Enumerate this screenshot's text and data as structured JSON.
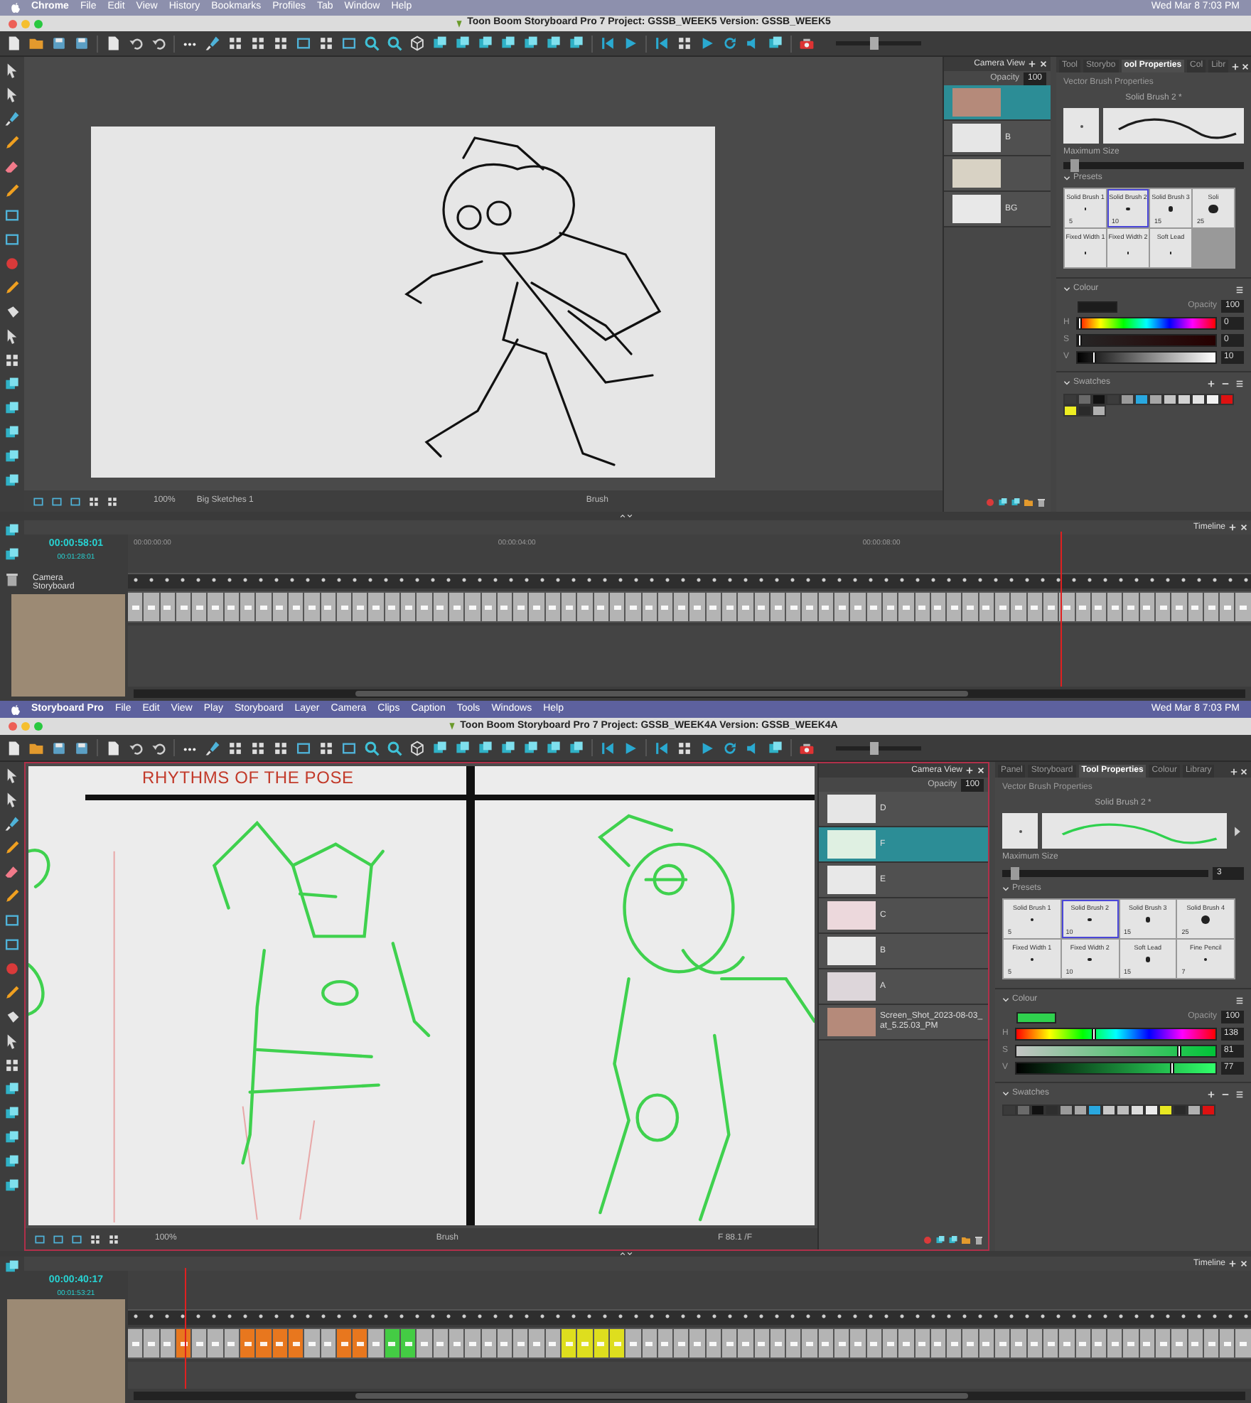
{
  "screens": [
    {
      "menu_bar": {
        "items": [
          "Chrome",
          "File",
          "Edit",
          "View",
          "History",
          "Bookmarks",
          "Profiles",
          "Tab",
          "Window",
          "Help"
        ],
        "clock": "Wed Mar 8  7:03 PM"
      },
      "window": {
        "title": "Toon Boom Storyboard Pro 7 Project: GSSB_WEEK5 Version: GSSB_WEEK5"
      },
      "toolbar": {
        "zoom_slider": {
          "level": 0.45
        }
      },
      "canvas": {
        "kind": "single",
        "status": {
          "zoom": "100%",
          "layer": "Big Sketches 1",
          "tool": "Brush"
        }
      },
      "camera_view": {
        "title": "Camera View",
        "opacity_label": "Opacity",
        "opacity": "100",
        "layers": [
          {
            "kind": "photo",
            "selected": true
          },
          {
            "kind": "sketch",
            "label": "B",
            "selected": false
          },
          {
            "kind": "faded",
            "selected": false
          },
          {
            "kind": "blank",
            "label": "BG",
            "selected": false
          }
        ]
      },
      "properties": {
        "tabs": [
          {
            "label": "Tool",
            "selected": false
          },
          {
            "label": "Storybo",
            "selected": false
          },
          {
            "label": "ool Properties",
            "selected": true
          },
          {
            "label": "Col",
            "selected": false
          },
          {
            "label": "Libr",
            "selected": false
          }
        ],
        "section": "Vector Brush Properties",
        "brush_name": "Solid Brush 2 *",
        "max_size_label": "Maximum Size",
        "max_size": {
          "level": 0.04
        },
        "presets_label": "Presets",
        "presets": [
          {
            "name": "Solid Brush 1",
            "size": "5",
            "selected": false
          },
          {
            "name": "Solid Brush 2",
            "size": "10",
            "selected": true
          },
          {
            "name": "Solid Brush 3",
            "size": "15",
            "selected": false
          },
          {
            "name": "Soli",
            "size": "25",
            "selected": false
          },
          {
            "name": "Fixed Width 1",
            "selected": false
          },
          {
            "name": "Fixed Width 2",
            "selected": false
          },
          {
            "name": "Soft Lead",
            "selected": false
          }
        ],
        "colour_label": "Colour",
        "colour": {
          "color": "#1c1c1c"
        },
        "opacity_label": "Opacity",
        "opacity": "100",
        "channels": [
          {
            "kind": "h",
            "label": "H",
            "value": "0",
            "level": 0
          },
          {
            "kind": "s",
            "label": "S",
            "value": "0",
            "level": 0
          },
          {
            "kind": "v",
            "label": "V",
            "value": "10",
            "level": 0.1
          }
        ],
        "swatches_label": "Swatches",
        "swatches": [
          {
            "color": "#3a3a3a"
          },
          {
            "color": "#6a6a6a"
          },
          {
            "color": "#111111"
          },
          {
            "color": "#3c3c3c"
          },
          {
            "color": "#9a9a9a"
          },
          {
            "color": "#29a8e0"
          },
          {
            "color": "#a6a6a6"
          },
          {
            "color": "#c4c4c4"
          },
          {
            "color": "#d2d2d2"
          },
          {
            "color": "#e2e2e2"
          },
          {
            "color": "#f2f2f2"
          },
          {
            "color": "#dd1111"
          },
          {
            "color": "#eeee22"
          },
          {
            "color": "#2a2a2a"
          },
          {
            "color": "#b0b0b0"
          }
        ]
      },
      "timeline": {
        "title": "Timeline",
        "timecode": "00:00:58:01",
        "duration": "00:01:28:01",
        "ruler": [
          "00:00:00:00",
          "00:00:04:00",
          "00:00:08:00"
        ],
        "tracks": [
          "Camera",
          "Storyboard"
        ],
        "playhead": {
          "level": 0.83
        },
        "panels": [
          {
            "color": "#b4b4b4"
          },
          {
            "color": "#b4b4b4"
          },
          {
            "color": "#b4b4b4"
          },
          {
            "color": "#b4b4b4"
          },
          {
            "color": "#b4b4b4"
          },
          {
            "color": "#b4b4b4"
          },
          {
            "color": "#b4b4b4"
          },
          {
            "color": "#b4b4b4"
          },
          {
            "color": "#b4b4b4"
          },
          {
            "color": "#b4b4b4"
          },
          {
            "color": "#b4b4b4"
          },
          {
            "color": "#b4b4b4"
          },
          {
            "color": "#b4b4b4"
          },
          {
            "color": "#b4b4b4"
          },
          {
            "color": "#b4b4b4"
          },
          {
            "color": "#b4b4b4"
          },
          {
            "color": "#b4b4b4"
          },
          {
            "color": "#b4b4b4"
          },
          {
            "color": "#b4b4b4"
          },
          {
            "color": "#b4b4b4"
          },
          {
            "color": "#b4b4b4"
          },
          {
            "color": "#b4b4b4"
          },
          {
            "color": "#b4b4b4"
          },
          {
            "color": "#b4b4b4"
          },
          {
            "color": "#b4b4b4"
          },
          {
            "color": "#b4b4b4"
          },
          {
            "color": "#b4b4b4"
          },
          {
            "color": "#b4b4b4"
          },
          {
            "color": "#b4b4b4"
          },
          {
            "color": "#b4b4b4"
          },
          {
            "color": "#b4b4b4"
          },
          {
            "color": "#b4b4b4"
          },
          {
            "color": "#b4b4b4"
          },
          {
            "color": "#b4b4b4"
          },
          {
            "color": "#b4b4b4"
          },
          {
            "color": "#b4b4b4"
          },
          {
            "color": "#b4b4b4"
          },
          {
            "color": "#b4b4b4"
          },
          {
            "color": "#b4b4b4"
          },
          {
            "color": "#b4b4b4"
          },
          {
            "color": "#b4b4b4"
          },
          {
            "color": "#b4b4b4"
          },
          {
            "color": "#b4b4b4"
          },
          {
            "color": "#b4b4b4"
          },
          {
            "color": "#b4b4b4"
          },
          {
            "color": "#b4b4b4"
          },
          {
            "color": "#b4b4b4"
          },
          {
            "color": "#b4b4b4"
          },
          {
            "color": "#b4b4b4"
          },
          {
            "color": "#b4b4b4"
          },
          {
            "color": "#b4b4b4"
          },
          {
            "color": "#b4b4b4"
          },
          {
            "color": "#b4b4b4"
          },
          {
            "color": "#b4b4b4"
          },
          {
            "color": "#b4b4b4"
          },
          {
            "color": "#b4b4b4"
          },
          {
            "color": "#b4b4b4"
          },
          {
            "color": "#b4b4b4"
          },
          {
            "color": "#b4b4b4"
          },
          {
            "color": "#b4b4b4"
          },
          {
            "color": "#b4b4b4"
          },
          {
            "color": "#b4b4b4"
          },
          {
            "color": "#b4b4b4"
          },
          {
            "color": "#b4b4b4"
          },
          {
            "color": "#b4b4b4"
          },
          {
            "color": "#b4b4b4"
          },
          {
            "color": "#b4b4b4"
          },
          {
            "color": "#b4b4b4"
          },
          {
            "color": "#b4b4b4"
          },
          {
            "color": "#b4b4b4"
          }
        ]
      }
    },
    {
      "menu_bar": {
        "items": [
          "Storyboard Pro",
          "File",
          "Edit",
          "View",
          "Play",
          "Storyboard",
          "Layer",
          "Camera",
          "Clips",
          "Caption",
          "Tools",
          "Windows",
          "Help"
        ],
        "clock": "Wed Mar 8  7:03 PM"
      },
      "window": {
        "title": "Toon Boom Storyboard Pro 7 Project: GSSB_WEEK4A Version: GSSB_WEEK4A"
      },
      "toolbar": {
        "zoom_slider": {
          "level": 0.45
        }
      },
      "canvas": {
        "kind": "double",
        "caption": "RHYTHMS OF THE POSE",
        "status": {
          "zoom": "100%",
          "tool": "Brush",
          "frame": "F 88.1 /F"
        }
      },
      "camera_view": {
        "title": "Camera View",
        "opacity_label": "Opacity",
        "opacity": "100",
        "layers": [
          {
            "kind": "sketch",
            "label": "D",
            "selected": false
          },
          {
            "kind": "green",
            "label": "F",
            "selected": true
          },
          {
            "kind": "blank",
            "label": "E",
            "selected": false
          },
          {
            "kind": "pink",
            "label": "C",
            "selected": false
          },
          {
            "kind": "blank",
            "label": "B",
            "selected": false
          },
          {
            "kind": "lines",
            "label": "A",
            "selected": false
          },
          {
            "kind": "photo",
            "label": "Screen_Shot_2023-08-03_at_5.25.03_PM",
            "selected": false
          }
        ]
      },
      "properties": {
        "tabs": [
          {
            "label": "Panel",
            "selected": false
          },
          {
            "label": "Storyboard",
            "selected": false
          },
          {
            "label": "Tool Properties",
            "selected": true
          },
          {
            "label": "Colour",
            "selected": false
          },
          {
            "label": "Library",
            "selected": false
          }
        ],
        "section": "Vector Brush Properties",
        "brush_name": "Solid Brush 2 *",
        "max_size_label": "Maximum Size",
        "max_size": {
          "level": 0.04,
          "value": "3"
        },
        "presets_label": "Presets",
        "presets": [
          {
            "name": "Solid Brush 1",
            "size": "5",
            "selected": false
          },
          {
            "name": "Solid Brush 2",
            "size": "10",
            "selected": true
          },
          {
            "name": "Solid Brush 3",
            "size": "15",
            "selected": false
          },
          {
            "name": "Solid Brush 4",
            "size": "25",
            "selected": false
          },
          {
            "name": "Fixed Width 1",
            "size": "5",
            "selected": false
          },
          {
            "name": "Fixed Width 2",
            "size": "10",
            "selected": false
          },
          {
            "name": "Soft Lead",
            "size": "15",
            "selected": false
          },
          {
            "name": "Fine Pencil",
            "size": "7",
            "selected": false
          }
        ],
        "colour_label": "Colour",
        "colour": {
          "color": "#2fd14e"
        },
        "opacity_label": "Opacity",
        "opacity": "100",
        "channels": [
          {
            "kind": "h",
            "label": "H",
            "value": "138",
            "level": 0.38
          },
          {
            "kind": "s",
            "label": "S",
            "value": "81",
            "level": 0.81
          },
          {
            "kind": "v",
            "label": "V",
            "value": "77",
            "level": 0.77
          }
        ],
        "swatches_label": "Swatches",
        "swatches": [
          {
            "color": "#3a3a3a"
          },
          {
            "color": "#6a6a6a"
          },
          {
            "color": "#111111"
          },
          {
            "color": "#2e2e2e"
          },
          {
            "color": "#9a9a9a"
          },
          {
            "color": "#a8a8a8"
          },
          {
            "color": "#29a8e0"
          },
          {
            "color": "#c8c8c8"
          },
          {
            "color": "#bdbdbd"
          },
          {
            "color": "#dcdcdc"
          },
          {
            "color": "#ececec"
          },
          {
            "color": "#e8e822"
          },
          {
            "color": "#2a2a2a"
          },
          {
            "color": "#b0b0b0"
          },
          {
            "color": "#dd1111"
          }
        ]
      },
      "timeline": {
        "title": "Timeline",
        "timecode": "00:00:40:17",
        "duration": "00:01:53:21",
        "playhead": {
          "level": 0.05
        },
        "panels": [
          {
            "color": "#b4b4b4"
          },
          {
            "color": "#b4b4b4"
          },
          {
            "color": "#b4b4b4"
          },
          {
            "color": "#e8771e"
          },
          {
            "color": "#b4b4b4"
          },
          {
            "color": "#b4b4b4"
          },
          {
            "color": "#b4b4b4"
          },
          {
            "color": "#e8771e"
          },
          {
            "color": "#e8771e"
          },
          {
            "color": "#e8771e"
          },
          {
            "color": "#e8771e"
          },
          {
            "color": "#b4b4b4"
          },
          {
            "color": "#b4b4b4"
          },
          {
            "color": "#e8771e"
          },
          {
            "color": "#e8771e"
          },
          {
            "color": "#b4b4b4"
          },
          {
            "color": "#44cc44"
          },
          {
            "color": "#44cc44"
          },
          {
            "color": "#b4b4b4"
          },
          {
            "color": "#b4b4b4"
          },
          {
            "color": "#b4b4b4"
          },
          {
            "color": "#b4b4b4"
          },
          {
            "color": "#b4b4b4"
          },
          {
            "color": "#b4b4b4"
          },
          {
            "color": "#b4b4b4"
          },
          {
            "color": "#b4b4b4"
          },
          {
            "color": "#b4b4b4"
          },
          {
            "color": "#dede1e"
          },
          {
            "color": "#dede1e"
          },
          {
            "color": "#dede1e"
          },
          {
            "color": "#dede1e"
          },
          {
            "color": "#b4b4b4"
          },
          {
            "color": "#b4b4b4"
          },
          {
            "color": "#b4b4b4"
          },
          {
            "color": "#b4b4b4"
          },
          {
            "color": "#b4b4b4"
          },
          {
            "color": "#b4b4b4"
          },
          {
            "color": "#b4b4b4"
          },
          {
            "color": "#b4b4b4"
          },
          {
            "color": "#b4b4b4"
          },
          {
            "color": "#b4b4b4"
          },
          {
            "color": "#b4b4b4"
          },
          {
            "color": "#b4b4b4"
          },
          {
            "color": "#b4b4b4"
          },
          {
            "color": "#b4b4b4"
          },
          {
            "color": "#b4b4b4"
          },
          {
            "color": "#b4b4b4"
          },
          {
            "color": "#b4b4b4"
          },
          {
            "color": "#b4b4b4"
          },
          {
            "color": "#b4b4b4"
          },
          {
            "color": "#b4b4b4"
          },
          {
            "color": "#b4b4b4"
          },
          {
            "color": "#b4b4b4"
          },
          {
            "color": "#b4b4b4"
          },
          {
            "color": "#b4b4b4"
          },
          {
            "color": "#b4b4b4"
          },
          {
            "color": "#b4b4b4"
          },
          {
            "color": "#b4b4b4"
          },
          {
            "color": "#b4b4b4"
          },
          {
            "color": "#b4b4b4"
          },
          {
            "color": "#b4b4b4"
          },
          {
            "color": "#b4b4b4"
          },
          {
            "color": "#b4b4b4"
          },
          {
            "color": "#b4b4b4"
          },
          {
            "color": "#b4b4b4"
          },
          {
            "color": "#b4b4b4"
          },
          {
            "color": "#b4b4b4"
          },
          {
            "color": "#b4b4b4"
          },
          {
            "color": "#b4b4b4"
          },
          {
            "color": "#b4b4b4"
          }
        ]
      }
    }
  ]
}
